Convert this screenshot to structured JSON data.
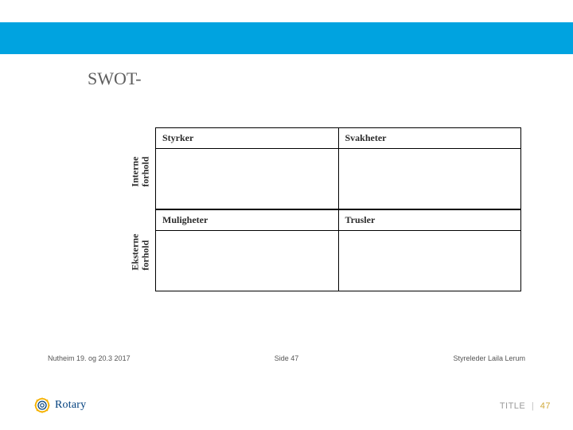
{
  "colors": {
    "accent_band": "#00a3e0",
    "logo_blue": "#003f7d",
    "logo_gold": "#f5b100",
    "page_number_gold": "#d0a93b"
  },
  "header": {
    "title": "SWOT-"
  },
  "swot": {
    "row_labels": [
      "Interne\nforhold",
      "Eksterne\nforhold"
    ],
    "headers_top": [
      "Styrker",
      "Svakheter"
    ],
    "headers_bottom": [
      "Muligheter",
      "Trusler"
    ]
  },
  "footer": {
    "left": "Nutheim 19. og 20.3 2017",
    "center": "Side 47",
    "right": "Styreleder Laila Lerum"
  },
  "logo": {
    "text": "Rotary",
    "icon": "gear-icon"
  },
  "bottom_right": {
    "label": "TITLE",
    "separator": "|",
    "page": "47"
  }
}
